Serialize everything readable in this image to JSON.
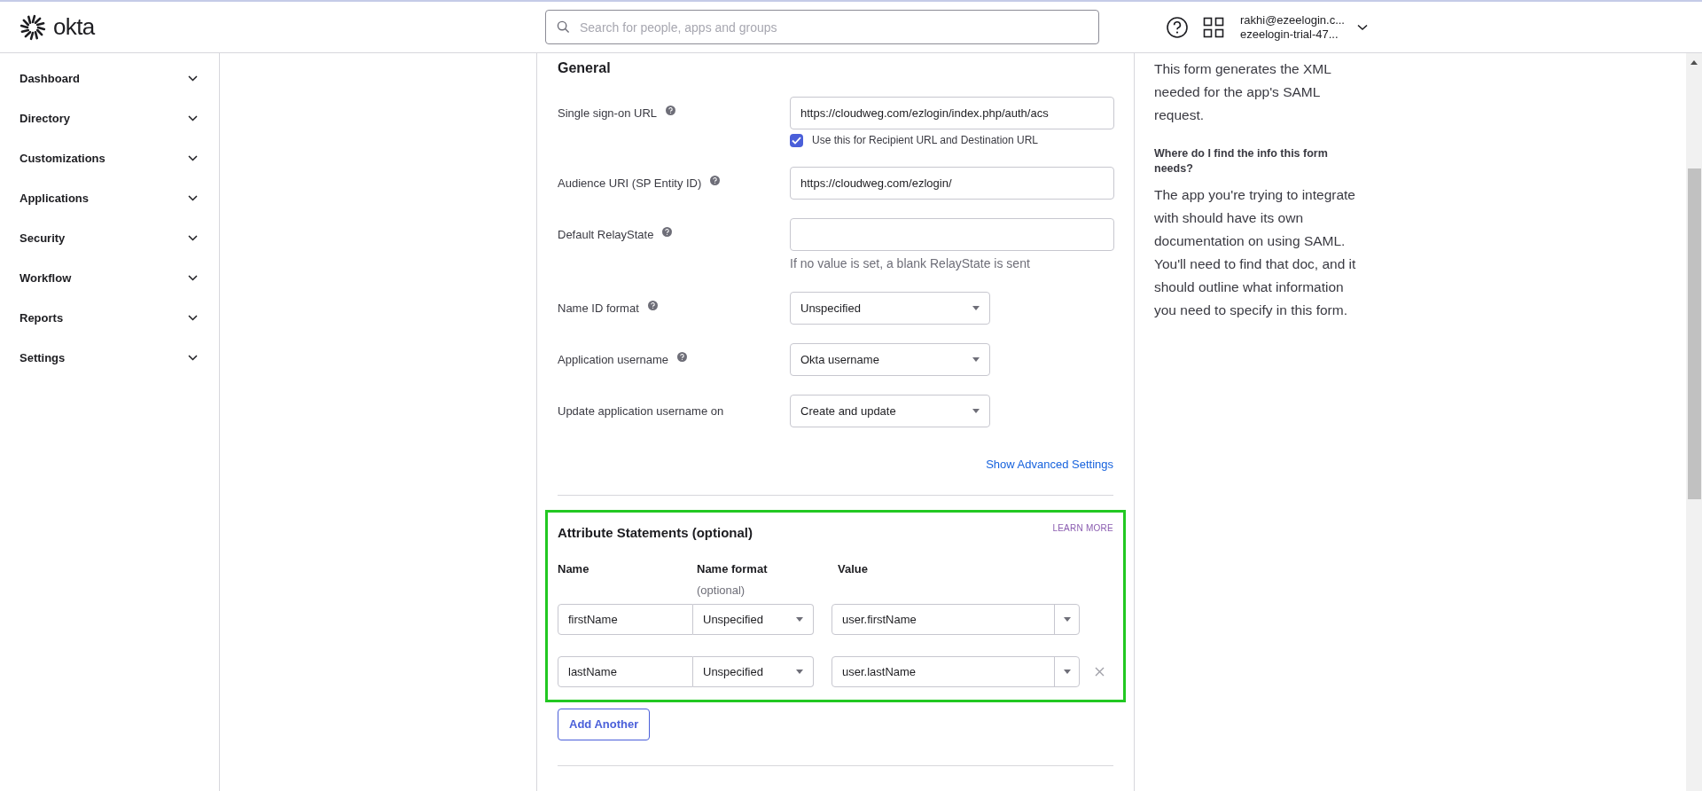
{
  "header": {
    "logo_text": "okta",
    "search": {
      "placeholder": "Search for people, apps and groups"
    },
    "user": {
      "email": "rakhi@ezeelogin.c...",
      "org": "ezeelogin-trial-47..."
    }
  },
  "sidebar": {
    "items": [
      {
        "label": "Dashboard"
      },
      {
        "label": "Directory"
      },
      {
        "label": "Customizations"
      },
      {
        "label": "Applications"
      },
      {
        "label": "Security"
      },
      {
        "label": "Workflow"
      },
      {
        "label": "Reports"
      },
      {
        "label": "Settings"
      }
    ]
  },
  "general": {
    "title": "General",
    "fields": [
      {
        "kind": "text",
        "label": "Single sign-on URL",
        "help": true,
        "value": "https://cloudweg.com/ezlogin/index.php/auth/acs",
        "checkbox": {
          "label": "Use this for Recipient URL and Destination URL",
          "checked": true
        }
      },
      {
        "kind": "text",
        "label": "Audience URI (SP Entity ID)",
        "help": true,
        "value": "https://cloudweg.com/ezlogin/"
      },
      {
        "kind": "text",
        "label": "Default RelayState",
        "help": true,
        "hint": "If no value is set, a blank RelayState is sent"
      },
      {
        "kind": "select",
        "label": "Name ID format",
        "help": true,
        "value": "Unspecified"
      },
      {
        "kind": "select",
        "label": "Application username",
        "help": true,
        "value": "Okta username"
      },
      {
        "kind": "select",
        "label": "Update application username on",
        "help": false,
        "value": "Create and update"
      }
    ],
    "advanced_link": "Show Advanced Settings"
  },
  "attributes": {
    "title": "Attribute Statements (optional)",
    "learn_more": "LEARN MORE",
    "columns": {
      "name": "Name",
      "name_format": "Name format",
      "name_format_note": "(optional)",
      "value": "Value"
    },
    "rows": [
      {
        "name": "firstName",
        "name_format": "Unspecified",
        "value": "user.firstName",
        "removable": false
      },
      {
        "name": "lastName",
        "name_format": "Unspecified",
        "value": "user.lastName",
        "removable": true
      }
    ],
    "add_button": "Add Another"
  },
  "help_panel": {
    "intro": "This form generates the XML needed for the app's SAML request.",
    "heading": "Where do I find the info this form needs?",
    "body": "The app you're trying to integrate with should have its own documentation on using SAML. You'll need to find that doc, and it should outline what information you need to specify in this form."
  }
}
